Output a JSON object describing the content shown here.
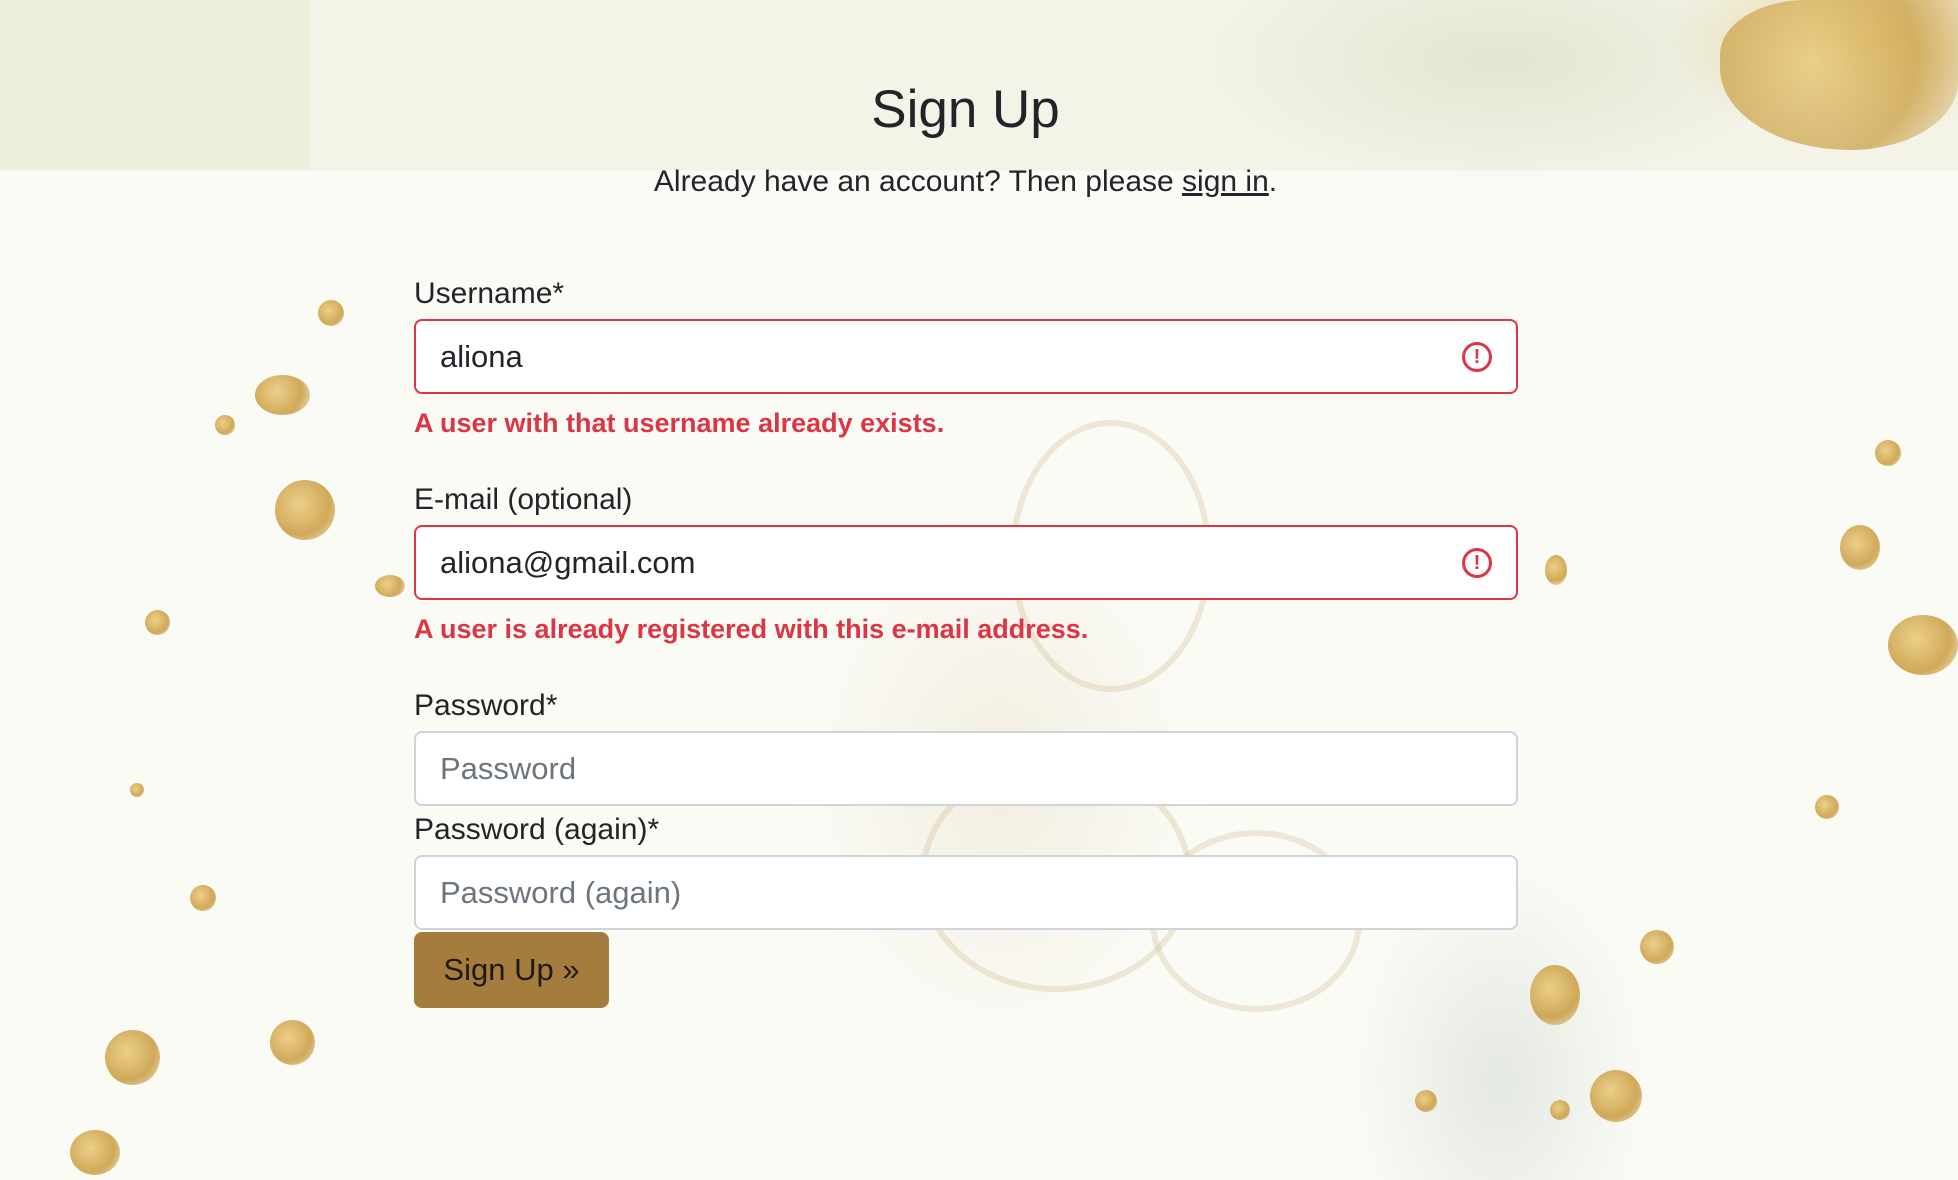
{
  "page": {
    "title": "Sign Up",
    "subtitle_prefix": "Already have an account? Then please ",
    "signin_link": "sign in",
    "subtitle_suffix": "."
  },
  "form": {
    "username": {
      "label": "Username*",
      "value": "aliona",
      "error": "A user with that username already exists."
    },
    "email": {
      "label": "E-mail (optional)",
      "value": "aliona@gmail.com",
      "error": "A user is already registered with this e-mail address."
    },
    "password": {
      "label": "Password*",
      "placeholder": "Password"
    },
    "password_again": {
      "label": "Password (again)*",
      "placeholder": "Password (again)"
    },
    "submit_label": "Sign Up »"
  },
  "colors": {
    "error": "#dc3545",
    "button": "#a47d3e",
    "border": "#ced4da"
  },
  "icons": {
    "field_error": "exclamation-circle-icon"
  }
}
